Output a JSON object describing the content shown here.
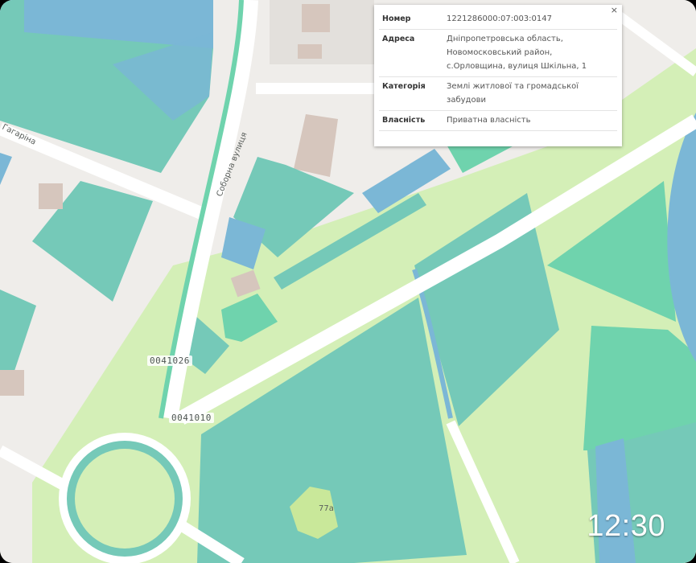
{
  "map": {
    "colors": {
      "background": "#efedea",
      "parcel_teal": "#75c9b8",
      "parcel_mint": "#6fd3ad",
      "parcel_blue": "#7bb7d6",
      "grass": "#d4efb7",
      "building": "#d6c6bd",
      "road": "#ffffff"
    },
    "street_labels": {
      "left_street": "Гагаріна",
      "vertical_street": "Соборна вулиця"
    },
    "parcel_codes": {
      "code_a": "0041026",
      "code_b": "0041010",
      "building_number": "77а"
    }
  },
  "popup": {
    "close_label": "×",
    "rows": [
      {
        "key": "Номер",
        "lines": [
          "1221286000:07:003:0147"
        ]
      },
      {
        "key": "Адреса",
        "lines": [
          "Дніпропетровська область,",
          "Новомосковський район,",
          "с.Орловщина, вулиця Шкільна, 1"
        ]
      },
      {
        "key": "Категорія",
        "lines": [
          "Землі житлової та громадської",
          "забудови"
        ]
      },
      {
        "key": "Власність",
        "lines": [
          "Приватна власність"
        ]
      }
    ]
  },
  "status_bar": {
    "clock": "12:30"
  }
}
